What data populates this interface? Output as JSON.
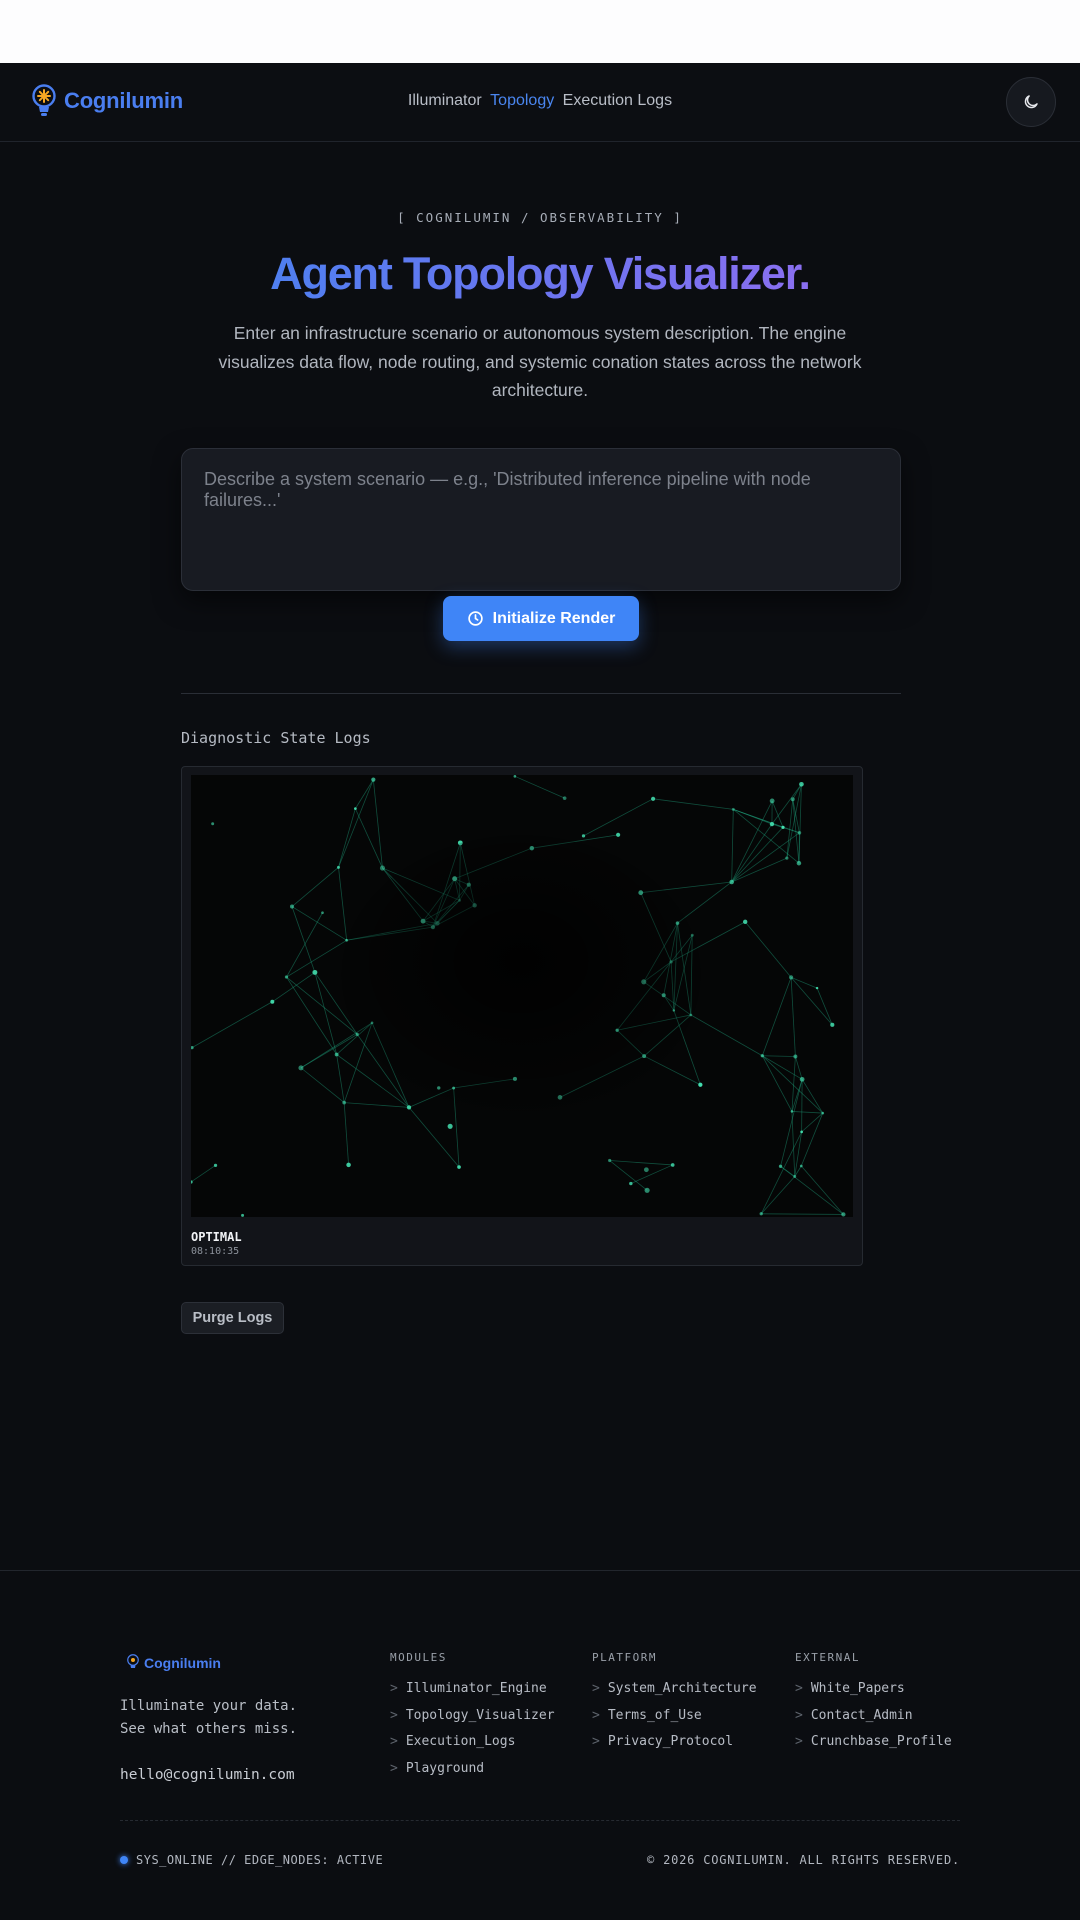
{
  "brand": {
    "name": "Cognilumin",
    "accent_color": "#4a7ef0",
    "icon": "lightbulb-icon"
  },
  "nav": {
    "items": [
      {
        "label": "Illuminator",
        "active": false
      },
      {
        "label": "Topology",
        "active": true
      },
      {
        "label": "Execution Logs",
        "active": false
      }
    ],
    "theme_toggle_icon": "moon-icon"
  },
  "hero": {
    "eyebrow": "[ COGNILUMIN / OBSERVABILITY ]",
    "title": "Agent Topology Visualizer.",
    "subtitle": "Enter an infrastructure scenario or autonomous system description. The engine visualizes data flow, node routing, and systemic conation states across the network architecture."
  },
  "scenario_input": {
    "value": "",
    "placeholder": "Describe a system scenario — e.g., 'Distributed inference pipeline with node failures...'"
  },
  "render_button": {
    "label": "Initialize Render",
    "icon": "clock-icon",
    "color": "#3f85f7"
  },
  "logs": {
    "section_title": "Diagnostic State Logs",
    "entries": [
      {
        "status": "OPTIMAL",
        "time": "08:10:35"
      }
    ],
    "purge_label": "Purge Logs"
  },
  "footer": {
    "brand": "Cognilumin",
    "tagline": [
      "Illuminate your data.",
      "See what others miss."
    ],
    "email": "hello@cognilumin.com",
    "columns": [
      {
        "heading": "MODULES",
        "links": [
          "Illuminator_Engine",
          "Topology_Visualizer",
          "Execution_Logs",
          "Playground"
        ]
      },
      {
        "heading": "PLATFORM",
        "links": [
          "System_Architecture",
          "Terms_of_Use",
          "Privacy_Protocol"
        ]
      },
      {
        "heading": "EXTERNAL",
        "links": [
          "White_Papers",
          "Contact_Admin",
          "Crunchbase_Profile"
        ]
      }
    ],
    "status": "SYS_ONLINE // EDGE_NODES: ACTIVE",
    "status_color": "#3f85f7",
    "copyright": "© 2026 COGNILUMIN. ALL RIGHTS RESERVED."
  }
}
